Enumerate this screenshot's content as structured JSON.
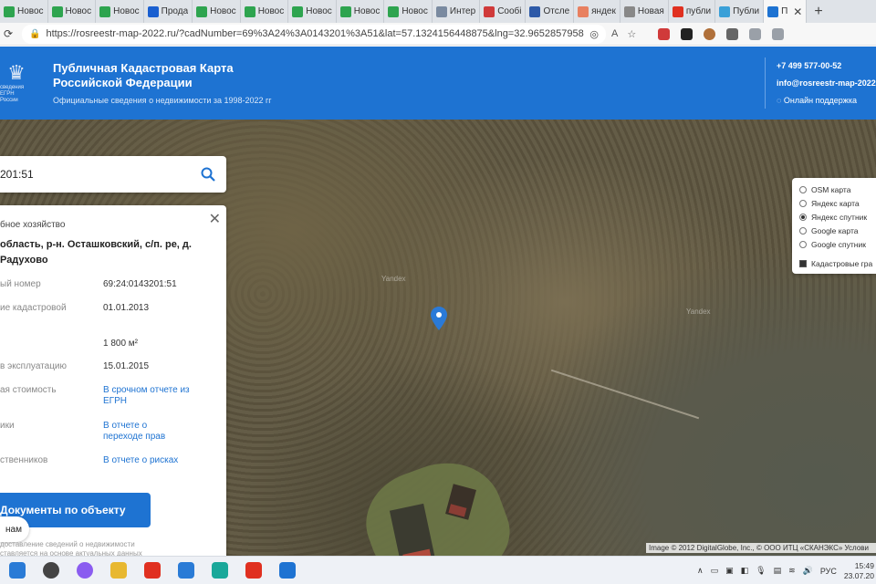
{
  "browser": {
    "tabs": [
      {
        "title": "Новос",
        "favicon": "#2ea44f"
      },
      {
        "title": "Новос",
        "favicon": "#2ea44f"
      },
      {
        "title": "Новос",
        "favicon": "#2ea44f"
      },
      {
        "title": "Прода",
        "favicon": "#1a5fd0"
      },
      {
        "title": "Новос",
        "favicon": "#2ea44f"
      },
      {
        "title": "Новос",
        "favicon": "#2ea44f"
      },
      {
        "title": "Новос",
        "favicon": "#2ea44f"
      },
      {
        "title": "Новос",
        "favicon": "#2ea44f"
      },
      {
        "title": "Новос",
        "favicon": "#2ea44f"
      },
      {
        "title": "Интер",
        "favicon": "#7a8aa0"
      },
      {
        "title": "Сообі",
        "favicon": "#d03a3a"
      },
      {
        "title": "Отсле",
        "favicon": "#2e5aa8"
      },
      {
        "title": "яндек",
        "favicon": "#e88060"
      },
      {
        "title": "Новая",
        "favicon": "#888888"
      },
      {
        "title": "публи",
        "favicon": "#e03020"
      },
      {
        "title": "Публи",
        "favicon": "#3aa0d8"
      },
      {
        "title": "П",
        "favicon": "#1e73d2",
        "active": true
      }
    ],
    "new_tab_label": "+",
    "url": "https://rosreestr-map-2022.ru/?cadNumber=69%3A24%3A0143201%3A51&lat=57.1324156448875&lng=32.96528579581..."
  },
  "site": {
    "emblem_text": "сведения\nЕГРН России",
    "title": "Публичная Кадастровая Карта Российской Федерации",
    "subtitle": "Официальные сведения о недвижимости за 1998-2022 гг",
    "phone": "+7 499 577-00-52",
    "email": "info@rosreestr-map-2022",
    "support": "Онлайн поддержка"
  },
  "search": {
    "value": "201:51"
  },
  "object": {
    "category": "бное хозяйство",
    "address": "область, р-н. Осташковский, с/п. ре, д. Радухово",
    "rows": [
      {
        "label": "ый номер",
        "value": "69:24:0143201:51",
        "link": false
      },
      {
        "label": "ие кадастровой",
        "value": "01.01.2013",
        "link": false
      },
      {
        "label": "",
        "value": "1 800 м²",
        "link": false
      },
      {
        "label": "в эксплуатацию",
        "value": "15.01.2015",
        "link": false
      },
      {
        "label": "ая стоимость",
        "value": "В срочном отчете из ЕГРН",
        "link": true
      },
      {
        "label": "ики",
        "value": "В отчете о переходе прав",
        "link": true
      },
      {
        "label": "ственников",
        "value": "В отчете о рисках",
        "link": true
      }
    ],
    "documents_button": "Документы по объекту",
    "chat_button": "нам",
    "disclaimer": "доставление сведений о недвижимости ставляется на основе актуальных данных"
  },
  "layers": {
    "options": [
      {
        "label": "OSM карта",
        "selected": false
      },
      {
        "label": "Яндекс карта",
        "selected": false
      },
      {
        "label": "Яндекс спутник",
        "selected": true
      },
      {
        "label": "Google карта",
        "selected": false
      },
      {
        "label": "Google спутник",
        "selected": false
      }
    ],
    "cadastral_label": "Кадастровые гра",
    "cadastral_checked": true
  },
  "map": {
    "watermark1": "Yandex",
    "watermark2": "Yandex",
    "copyright": "Image © 2012 DigitalGlobe, Inc., © ООО ИТЦ «СКАНЭКС» Услови"
  },
  "taskbar": {
    "apps": [
      {
        "name": "windows-start",
        "color": "#2a7bd6"
      },
      {
        "name": "search",
        "color": "#444444"
      },
      {
        "name": "alice",
        "color": "#8a5cf0"
      },
      {
        "name": "explorer",
        "color": "#e8b830"
      },
      {
        "name": "yandex-browser",
        "color": "#e03020"
      },
      {
        "name": "tasks",
        "color": "#2a7bd6"
      },
      {
        "name": "edge",
        "color": "#1aa89a"
      },
      {
        "name": "yandex",
        "color": "#e03020"
      },
      {
        "name": "mail",
        "color": "#1e73d2"
      }
    ],
    "lang": "РУС",
    "time": "15:49",
    "date": "23.07.20"
  }
}
